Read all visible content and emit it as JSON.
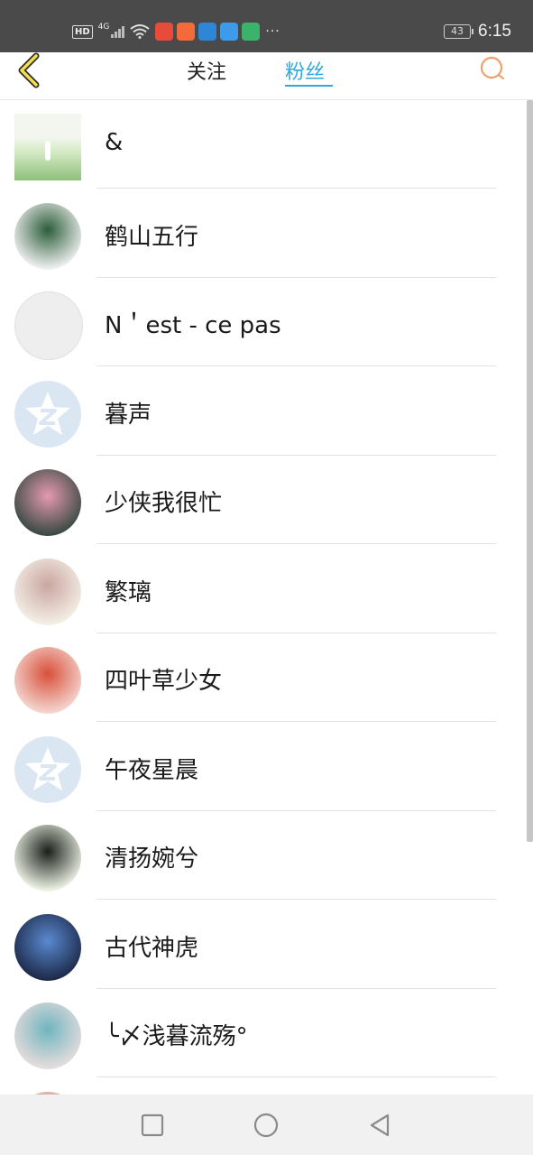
{
  "status_bar": {
    "hd": "HD",
    "network": "4G",
    "battery": "43",
    "time": "6:15",
    "more": "···",
    "app_icons": [
      {
        "name": "red-app-icon",
        "color": "#e84b3a"
      },
      {
        "name": "orange-app-icon",
        "color": "#f26b3a"
      },
      {
        "name": "blue-app-icon",
        "color": "#2f86d6"
      },
      {
        "name": "qq-browser-icon",
        "color": "#3d9be9"
      },
      {
        "name": "green-app-icon",
        "color": "#3bb36a"
      }
    ]
  },
  "header": {
    "tab_follow": "关注",
    "tab_fans": "粉丝",
    "active_tab": "粉丝",
    "accent_color": "#2fa9dc",
    "back_icon": "back-chevron-icon",
    "search_icon": "search-icon"
  },
  "fans": [
    {
      "name": "&",
      "avatar": "landscape-photo",
      "avatar_colors": [
        "#d8ecc8",
        "#8ec07a"
      ]
    },
    {
      "name": "鹤山五行",
      "avatar": "cartoon-striped",
      "avatar_colors": [
        "#f0f0f0",
        "#2c5e3a"
      ]
    },
    {
      "name": "N＇est - ce pas",
      "avatar": "text-card",
      "avatar_colors": [
        "#eeeeee",
        "#e4e4e4"
      ]
    },
    {
      "name": "暮声",
      "avatar": "default-qzone",
      "avatar_colors": [
        "#dbe6f3",
        "#ffffff"
      ]
    },
    {
      "name": "少侠我很忙",
      "avatar": "plum-blossom",
      "avatar_colors": [
        "#3a4a44",
        "#e59ab0"
      ]
    },
    {
      "name": "繁璃",
      "avatar": "anime-girl",
      "avatar_colors": [
        "#f3efe6",
        "#caa6a0"
      ]
    },
    {
      "name": "四叶草少女",
      "avatar": "anime-red-hair",
      "avatar_colors": [
        "#f4d6d0",
        "#d8503a"
      ]
    },
    {
      "name": "午夜星晨",
      "avatar": "default-qzone",
      "avatar_colors": [
        "#dbe6f3",
        "#ffffff"
      ]
    },
    {
      "name": "清扬婉兮",
      "avatar": "long-hair-silhouette",
      "avatar_colors": [
        "#eef3e6",
        "#1a1f1a"
      ]
    },
    {
      "name": "古代神虎",
      "avatar": "city-night",
      "avatar_colors": [
        "#1d2a4a",
        "#5a8ad0"
      ]
    },
    {
      "name": "╰〆浅暮流殇°",
      "avatar": "girl-photo",
      "avatar_colors": [
        "#e6dcdc",
        "#6fb5c0"
      ]
    },
    {
      "name": "",
      "avatar": "partial",
      "avatar_colors": [
        "#e8c8c0",
        "#c49088"
      ]
    }
  ],
  "nav": {
    "recent": "recent-apps-square-icon",
    "home": "home-circle-icon",
    "back": "back-triangle-icon"
  }
}
